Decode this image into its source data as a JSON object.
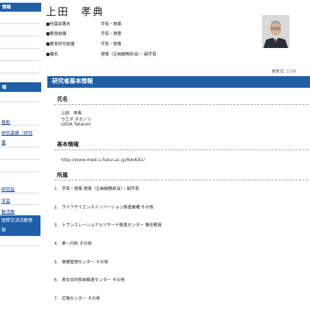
{
  "sidebar": {
    "top_label": "情報",
    "mid_label": "報",
    "links": [
      "表彰",
      "研究業績（研究",
      "書"
    ],
    "lower": [
      "研究会",
      "学会",
      "動活動"
    ],
    "lower_blue": [
      "国際交流活動情",
      "報"
    ]
  },
  "header": {
    "name": "上田　孝典",
    "rows": [
      {
        "label": "■所属部署名",
        "value": "学長・理事"
      },
      {
        "label": "■教員組織",
        "value": "学長・理事"
      },
      {
        "label": "■教育研究組織",
        "value": "学長・理事"
      },
      {
        "label": "■職名",
        "value": "理事（企画戦略担当）・副学長"
      }
    ],
    "updated": "更新日: 17/0"
  },
  "main": {
    "section_title": "研究者基本情報",
    "name_heading": "氏名",
    "name_lines": [
      "上田　孝典",
      "ウエダ タカノリ",
      "UEDA Takanori"
    ],
    "basic_heading": "基本情報",
    "url": "http://www.med.u-fukui.ac.jp/NAIKA1/",
    "affiliation_heading": "所属",
    "affiliations": [
      {
        "num": "1.",
        "text": "学長・理事 理事（企画戦略担当）・副学長"
      },
      {
        "num": "2.",
        "text": "ライフサイエンスイノベーション推進機構 その他"
      },
      {
        "num": "3.",
        "text": "トランスレーショナルリサーチ推進センター 兼任教員"
      },
      {
        "num": "4.",
        "text": "第一内科 その他"
      },
      {
        "num": "5.",
        "text": "保健管理センター その他"
      },
      {
        "num": "6.",
        "text": "男女共同参画推進センター その他"
      },
      {
        "num": "7.",
        "text": "広報センター その他"
      }
    ]
  },
  "colors": {
    "accent": "#1f5fa8",
    "link": "#0b3c8c"
  }
}
